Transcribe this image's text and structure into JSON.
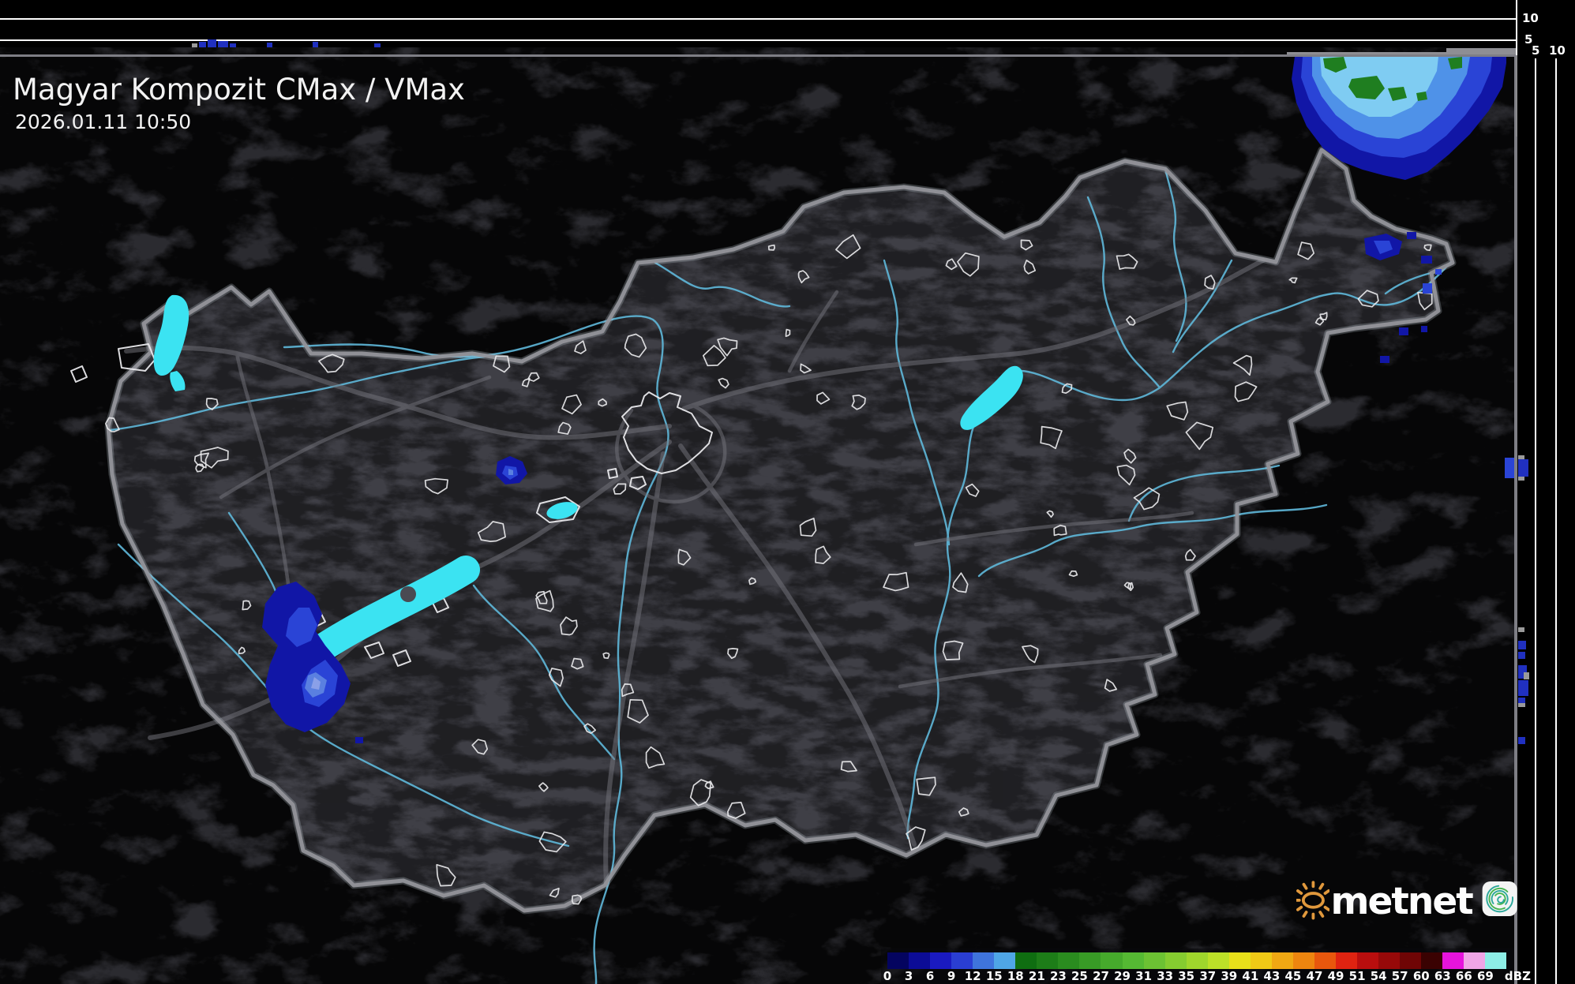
{
  "header": {
    "title": "Magyar Kompozit CMax / VMax",
    "datetime": "2026.01.11 10:50"
  },
  "profiles": {
    "top_ticks": [
      "10",
      "5"
    ],
    "right_ticks": [
      "5",
      "10"
    ]
  },
  "legend": {
    "unit": "dBZ",
    "tick_labels": [
      "0",
      "3",
      "6",
      "9",
      "12",
      "15",
      "18",
      "21",
      "23",
      "25",
      "27",
      "29",
      "31",
      "33",
      "35",
      "37",
      "39",
      "41",
      "43",
      "45",
      "47",
      "49",
      "51",
      "54",
      "57",
      "60",
      "63",
      "66",
      "69"
    ],
    "colors": [
      "#04045f",
      "#0c0c96",
      "#1a1ac0",
      "#2a3ed2",
      "#3f74dc",
      "#4fa6e6",
      "#0f6e11",
      "#1d7d18",
      "#2a8c1f",
      "#389b26",
      "#46aa2c",
      "#55b933",
      "#6cc233",
      "#85cc30",
      "#9fd62c",
      "#bce028",
      "#e8e01a",
      "#f0c916",
      "#f0a713",
      "#ee850f",
      "#e8570d",
      "#df2311",
      "#b90e0e",
      "#970909",
      "#6f0505",
      "#3a0202",
      "#e614dc",
      "#f0a5e6",
      "#8deee6"
    ]
  },
  "branding": {
    "logo_text": "metnet",
    "sun_color": "#e0983c",
    "app_icon_teal": "#2ba79b",
    "app_icon_green": "#45b54e"
  },
  "map": {
    "colors": {
      "outside_terrain": "#2b2b30",
      "inside_terrain": "#3f3f46",
      "country_border": "#93939a",
      "river": "#5fb8da",
      "road": "#75757d",
      "lake": "#3be3f2",
      "settlement_outline": "#e9e9ec",
      "precip_navy": "#1116a6",
      "precip_blue": "#2a44d6",
      "precip_light_blue": "#4f92e8",
      "precip_pale_blue": "#7fccf2",
      "precip_green": "#1f7e20"
    }
  }
}
